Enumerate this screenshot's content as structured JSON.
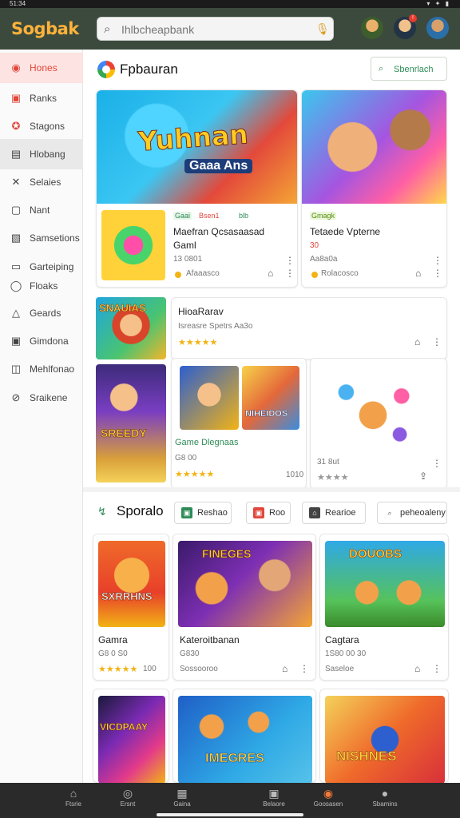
{
  "status": {
    "time": "51:34",
    "icons": "▾ ✦ ▮"
  },
  "app": {
    "logo": "Sogbak",
    "search_placeholder": "Ihlbcheapbank"
  },
  "sidebar": {
    "items": [
      {
        "label": "Hones",
        "icon": "home-icon"
      },
      {
        "label": "Ranks",
        "icon": "ranks-icon"
      },
      {
        "label": "Stagons",
        "icon": "stagons-icon"
      },
      {
        "label": "Hlobang",
        "icon": "hlobang-icon"
      },
      {
        "label": "Selaies",
        "icon": "selaies-icon"
      },
      {
        "label": "Nant",
        "icon": "nant-icon"
      },
      {
        "label": "Samsetions",
        "icon": "samsetions-icon"
      },
      {
        "label": "Garteiping",
        "icon": "garteiping-icon"
      },
      {
        "label": "Floaks",
        "icon": "floaks-icon"
      },
      {
        "label": "Geards",
        "icon": "geards-icon"
      },
      {
        "label": "Gimdona",
        "icon": "gimdona-icon"
      },
      {
        "label": "Mehlfonao",
        "icon": "mehlfonao-icon"
      },
      {
        "label": "Sraikene",
        "icon": "sraikene-icon"
      }
    ]
  },
  "section1": {
    "title": "Fpbauran",
    "button": "Sbenrlach"
  },
  "hero_left": {
    "line1": "Yuhnan",
    "line2": "Gaaa Ans"
  },
  "card_a": {
    "tag1": "Gaai",
    "tag2": "Bsen1",
    "tag3": "blb",
    "title1": "Maefran Qcsasaasad",
    "title2": "Gaml",
    "meta": "13 0801",
    "sub": "Afaaasco"
  },
  "card_b": {
    "tag": "Gmagk",
    "title": "Tetaede Vpterne",
    "sub1": "30",
    "meta": "Aa8a0a",
    "sub": "Rolacosco"
  },
  "card_c": {
    "title": "HioaRarav",
    "meta": "Isreasre Spetrs Aa3o",
    "stars": "★★★★★"
  },
  "card_d": {
    "title": "Game Dlegnaas",
    "meta": "G8 00",
    "stars": "★★★★★",
    "count": "1010"
  },
  "card_e": {
    "meta": "31 8ut",
    "stars": "★★★★"
  },
  "section2": {
    "title": "Sporalo",
    "chips": [
      "Reshao",
      "Roo",
      "Rearioe",
      "peheoaleny"
    ]
  },
  "grid": [
    {
      "title": "Gamra",
      "meta": "G8 0 S0",
      "stars": "★★★★★",
      "count": "100"
    },
    {
      "title": "Kateroitbanan",
      "meta": "G830",
      "sub": "Sossooroo"
    },
    {
      "title": "Cagtara",
      "meta": "1S80 00 30",
      "sub": "Saseloe"
    }
  ],
  "art_text": {
    "g1": "SXRRHNS",
    "g2": "FINEGES",
    "g3": "DOUOBS",
    "g4": "VICDPAAY",
    "g5": "IMEGRES",
    "g6": "NISHNES",
    "c1": "SNAUIAS",
    "c2": "SREEDY",
    "c3": "NIHEIDOS"
  },
  "bottom_nav": [
    {
      "label": "Ftsrie",
      "icon": "home-icon"
    },
    {
      "label": "Ersnt",
      "icon": "compass-icon"
    },
    {
      "label": "Gaina",
      "icon": "grid-icon"
    },
    {
      "label": "Belaore",
      "icon": "card-icon"
    },
    {
      "label": "Goosasen",
      "icon": "flame-icon"
    },
    {
      "label": "Sbamins",
      "icon": "person-icon"
    }
  ],
  "colors": {
    "appbar": "#3b4a3d",
    "accent": "#e2473b",
    "green": "#2e8b57",
    "star": "#f2b315"
  }
}
